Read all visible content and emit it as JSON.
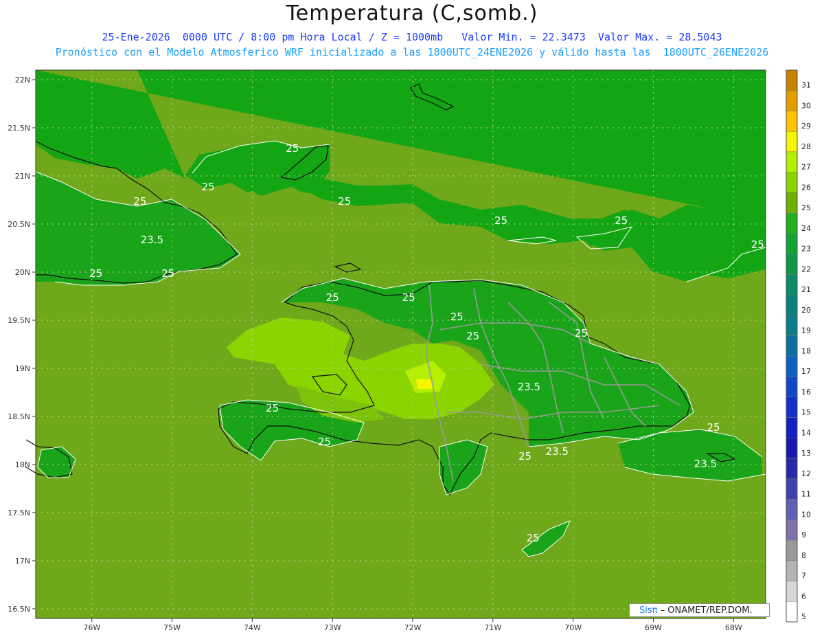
{
  "title": "Temperatura (C,somb.)",
  "subtitle_line1": "25-Ene-2026  0000 UTC / 8:00 pm Hora Local / Z = 1000mb   Valor Min. = 22.3473  Valor Max. = 28.5043",
  "subtitle_line2": "Pronóstico con el Modelo Atmosferico WRF inicializado a las 1800UTC_24ENE2026 y válido hasta las  1800UTC_26ENE2026",
  "credit": {
    "brand": "Sisπ",
    "text": " – ONAMET/REP.DOM."
  },
  "map_data": {
    "lat_ticks": [
      "22N",
      "21.5N",
      "21N",
      "20.5N",
      "20N",
      "19.5N",
      "19N",
      "18.5N",
      "18N",
      "17.5N",
      "17N",
      "16.5N"
    ],
    "lat_values": [
      22,
      21.5,
      21,
      20.5,
      20,
      19.5,
      19,
      18.5,
      18,
      17.5,
      17,
      16.5
    ],
    "lon_ticks": [
      "76W",
      "75W",
      "74W",
      "73W",
      "72W",
      "71W",
      "70W",
      "69W",
      "68W"
    ],
    "lon_values": [
      -76,
      -75,
      -74,
      -73,
      -72,
      -71,
      -70,
      -69,
      -68
    ],
    "lat_range": [
      16.4,
      22.1
    ],
    "lon_range": [
      -76.7,
      -67.6
    ],
    "contour_labels": [
      {
        "text": "25",
        "lon": -73.5,
        "lat": 21.25
      },
      {
        "text": "25",
        "lon": -74.55,
        "lat": 20.85
      },
      {
        "text": "25",
        "lon": -75.4,
        "lat": 20.7
      },
      {
        "text": "25",
        "lon": -72.85,
        "lat": 20.7
      },
      {
        "text": "25",
        "lon": -70.9,
        "lat": 20.5
      },
      {
        "text": "25",
        "lon": -69.4,
        "lat": 20.5
      },
      {
        "text": "25",
        "lon": -67.7,
        "lat": 20.25
      },
      {
        "text": "23.5",
        "lon": -75.25,
        "lat": 20.3
      },
      {
        "text": "25",
        "lon": -75.95,
        "lat": 19.95
      },
      {
        "text": "25",
        "lon": -75.05,
        "lat": 19.95
      },
      {
        "text": "25",
        "lon": -73.0,
        "lat": 19.7
      },
      {
        "text": "25",
        "lon": -72.05,
        "lat": 19.7
      },
      {
        "text": "25",
        "lon": -71.45,
        "lat": 19.5
      },
      {
        "text": "25",
        "lon": -71.25,
        "lat": 19.3
      },
      {
        "text": "25",
        "lon": -69.9,
        "lat": 19.33
      },
      {
        "text": "23.5",
        "lon": -70.55,
        "lat": 18.77
      },
      {
        "text": "25",
        "lon": -73.75,
        "lat": 18.55
      },
      {
        "text": "25",
        "lon": -73.1,
        "lat": 18.2
      },
      {
        "text": "25",
        "lon": -70.6,
        "lat": 18.05
      },
      {
        "text": "23.5",
        "lon": -70.2,
        "lat": 18.1
      },
      {
        "text": "25",
        "lon": -68.25,
        "lat": 18.35
      },
      {
        "text": "23.5",
        "lon": -68.35,
        "lat": 17.97
      },
      {
        "text": "25",
        "lon": -70.5,
        "lat": 17.2
      }
    ]
  },
  "colorbar": {
    "labels": [
      "31",
      "30",
      "29",
      "28",
      "27",
      "26",
      "25",
      "24",
      "23",
      "22",
      "21",
      "20",
      "19",
      "18",
      "17",
      "16",
      "15",
      "14",
      "13",
      "12",
      "11",
      "10",
      "9",
      "8",
      "7",
      "6",
      "5"
    ],
    "colors": [
      "#c88400",
      "#e49e00",
      "#ffc400",
      "#f6f600",
      "#b4f000",
      "#8ad400",
      "#6cb000",
      "#20b020",
      "#12a432",
      "#109648",
      "#0c8c66",
      "#0a8078",
      "#0a7c8c",
      "#0d70a4",
      "#1060c0",
      "#1048c8",
      "#1030c8",
      "#1420c0",
      "#1818b0",
      "#2828a8",
      "#4040b0",
      "#6060b4",
      "#8070b0",
      "#9a9a9a",
      "#b4b4b4",
      "#d8d8d8",
      "#ffffff"
    ]
  }
}
